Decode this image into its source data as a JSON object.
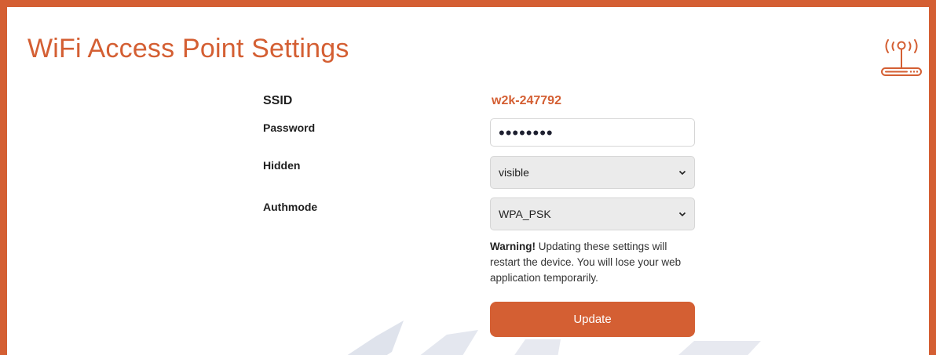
{
  "header": {
    "title": "WiFi Access Point Settings",
    "icon": "wifi-router-icon"
  },
  "form": {
    "ssid": {
      "label": "SSID",
      "value": "w2k-247792"
    },
    "password": {
      "label": "Password",
      "value": "••••••••"
    },
    "hidden": {
      "label": "Hidden",
      "selected": "visible"
    },
    "authmode": {
      "label": "Authmode",
      "selected": "WPA_PSK"
    },
    "warning": {
      "strong": "Warning!",
      "text": " Updating these settings will restart the device. You will lose your web application temporarily."
    },
    "update_label": "Update"
  },
  "colors": {
    "accent": "#d45f33",
    "select_bg": "#ebebeb"
  }
}
